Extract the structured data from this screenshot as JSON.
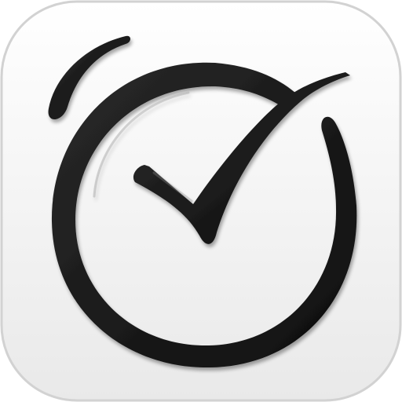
{
  "icon": {
    "name": "alarm-clock-checkmark-icon",
    "colors": {
      "tile_top": "#ffffff",
      "tile_bottom": "#e9e9e9",
      "tile_edge": "#d2d2d2",
      "glyph_dark": "#0d0d0d",
      "glyph_mid": "#2a2a2a",
      "glyph_highlight": "#8a8a8a"
    }
  }
}
